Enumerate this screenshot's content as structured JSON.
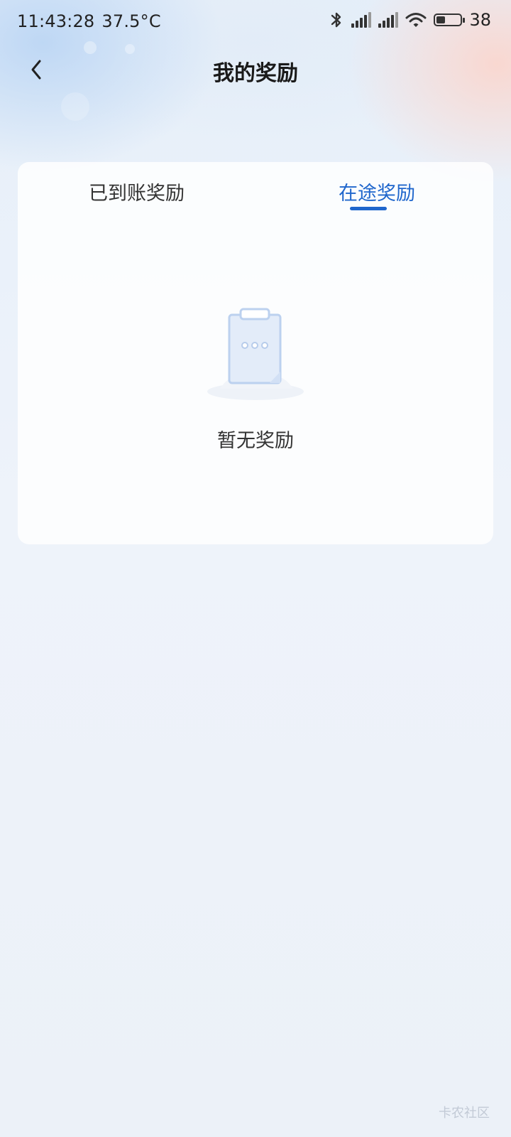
{
  "status_bar": {
    "time": "11:43:28",
    "temperature": "37.5°C",
    "battery_level": "38",
    "battery_fraction": 0.38,
    "icons": [
      "bluetooth-icon",
      "signal-icon",
      "signal-icon",
      "wifi-icon",
      "battery-icon"
    ]
  },
  "header": {
    "title": "我的奖励",
    "back_icon": "chevron-left-icon"
  },
  "tabs": [
    {
      "label": "已到账奖励",
      "active": false
    },
    {
      "label": "在途奖励",
      "active": true
    }
  ],
  "empty_state": {
    "icon": "clipboard-icon",
    "message": "暂无奖励"
  },
  "watermark": "卡农社区",
  "colors": {
    "accent": "#1f66cc",
    "text_primary": "#1a1a1a",
    "text_secondary": "#333333"
  }
}
